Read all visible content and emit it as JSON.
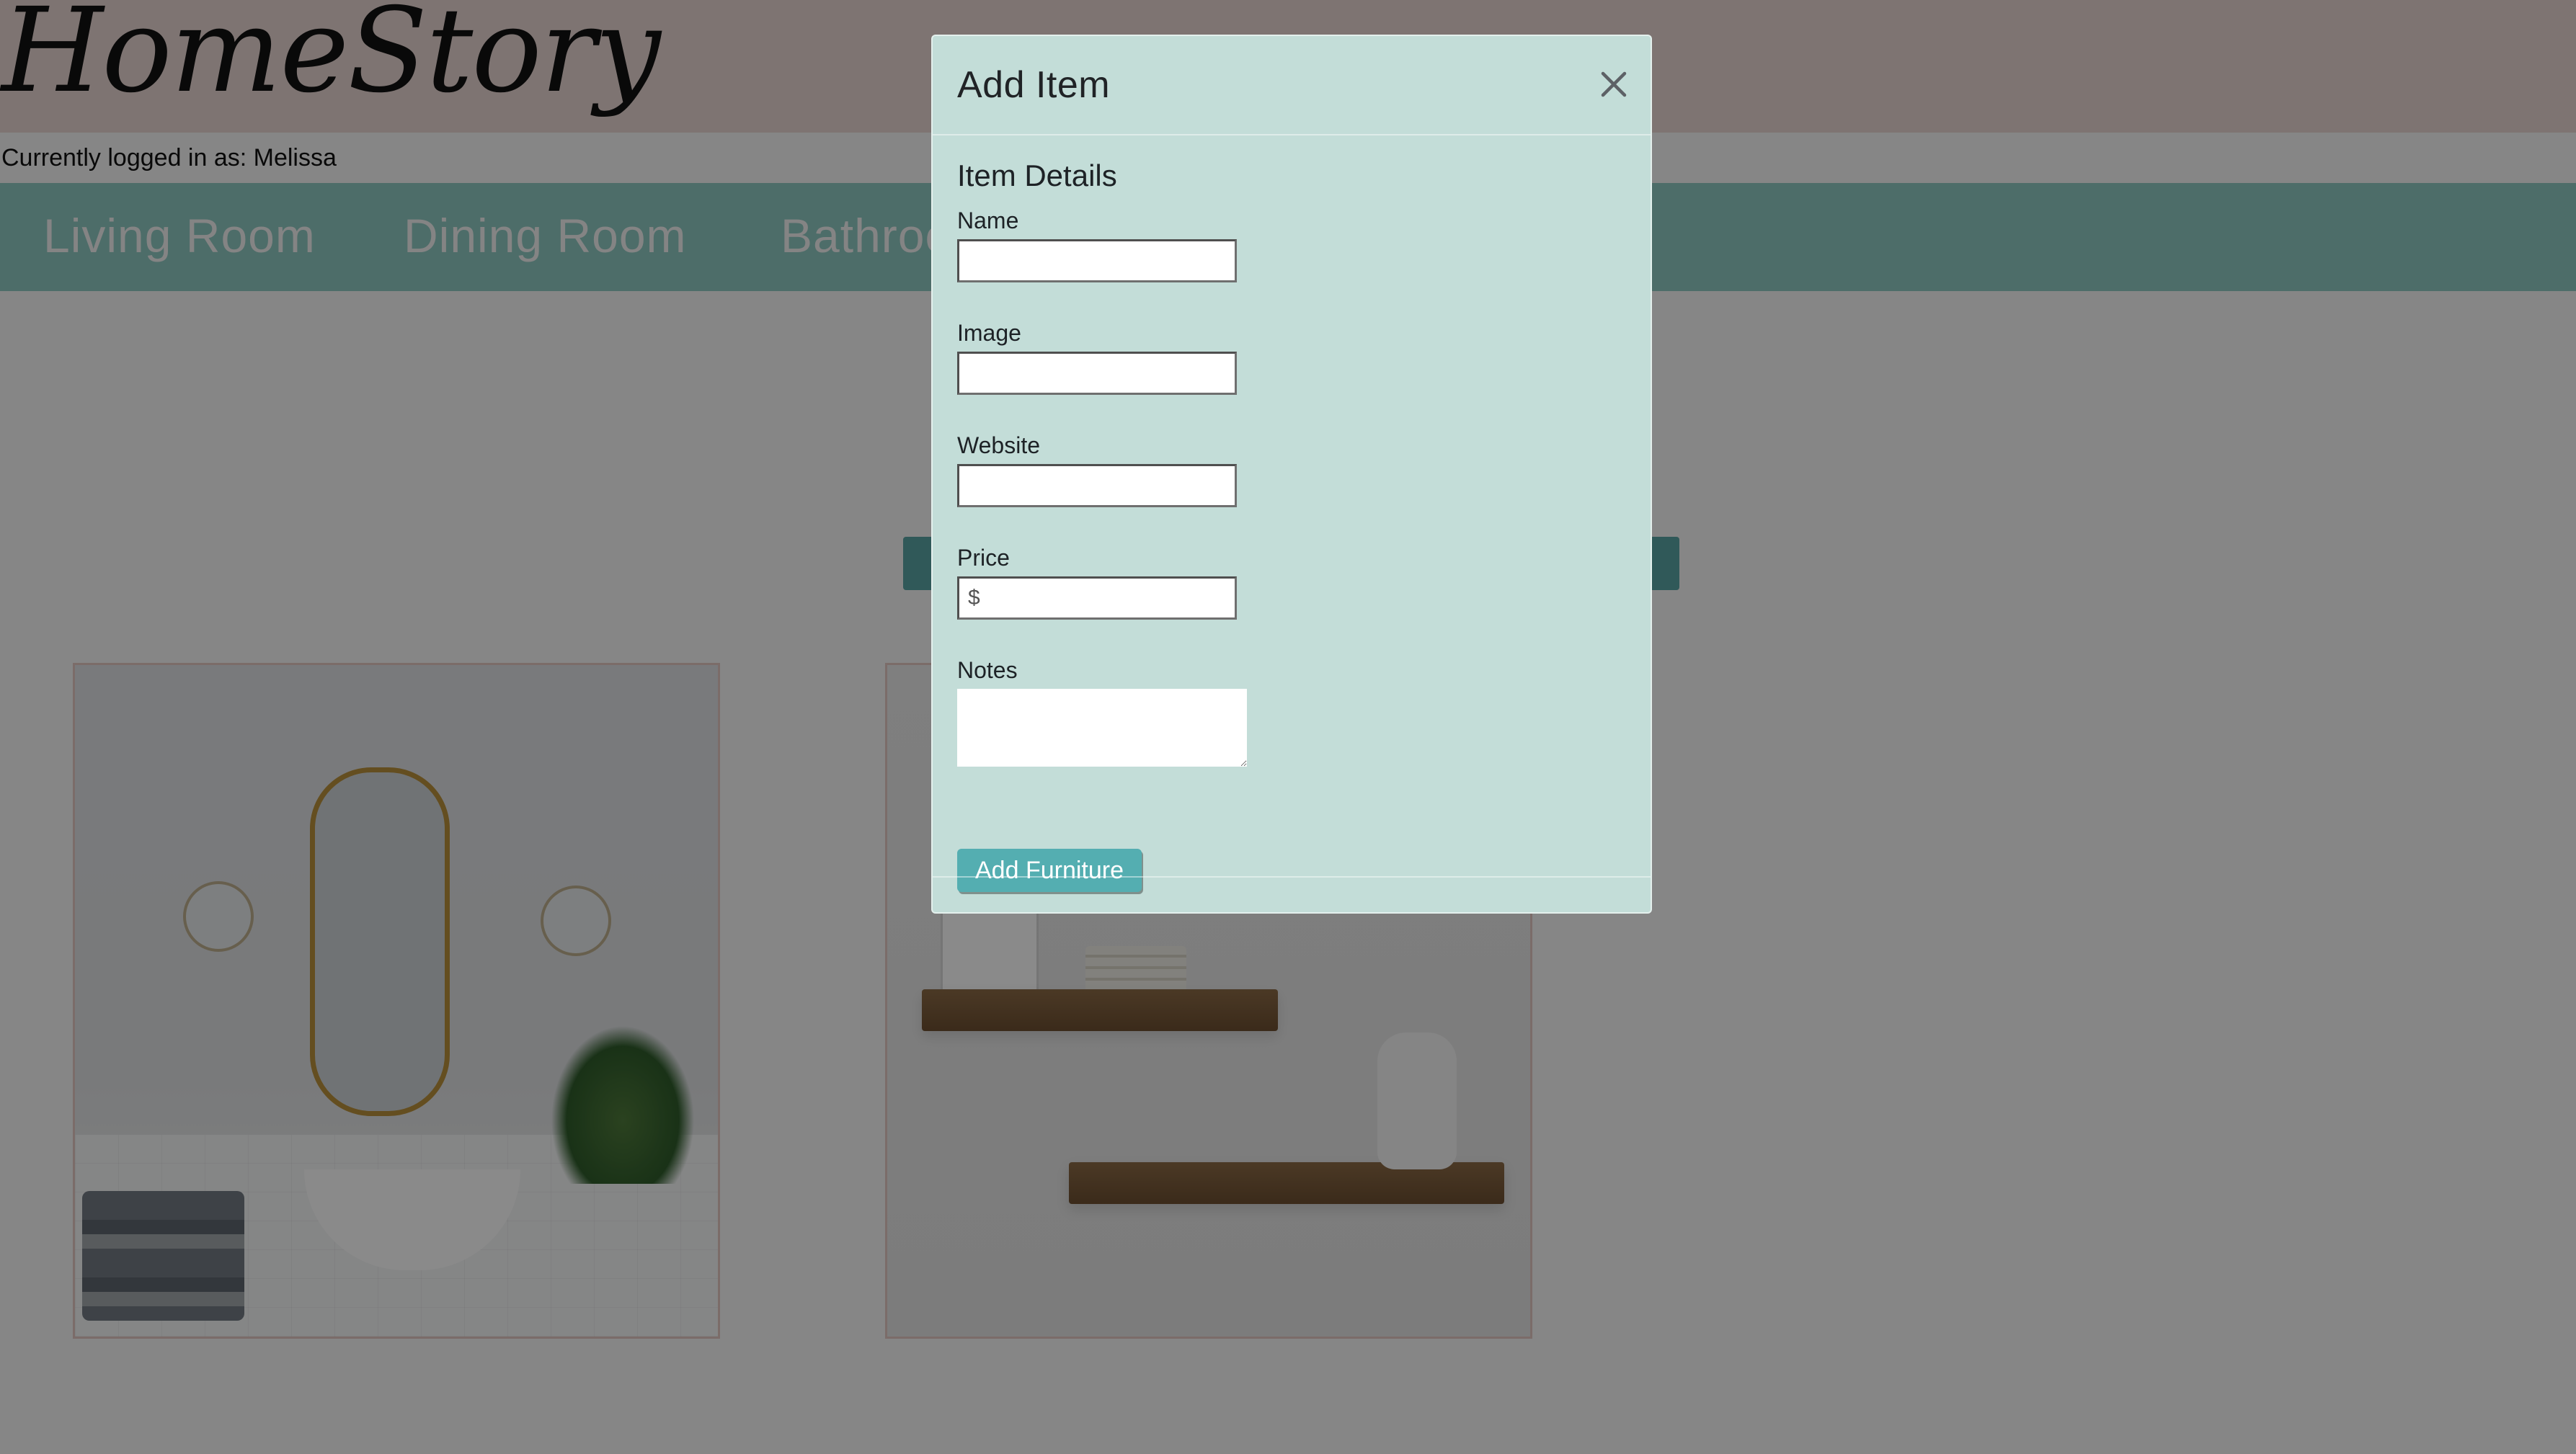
{
  "app": {
    "brand": "HomeStory",
    "logged_in_text": "Currently logged in as: Melissa"
  },
  "nav": {
    "items": [
      {
        "label": "Living Room"
      },
      {
        "label": "Dining Room"
      },
      {
        "label": "Bathroom"
      }
    ]
  },
  "modal": {
    "title": "Add Item",
    "section_title": "Item Details",
    "fields": {
      "name_label": "Name",
      "image_label": "Image",
      "website_label": "Website",
      "price_label": "Price",
      "notes_label": "Notes",
      "price_placeholder": "$"
    },
    "submit_label": "Add Furniture",
    "close_icon": "close-icon"
  },
  "colors": {
    "header_bg": "#e9d7d3",
    "nav_bg": "#8fc9c2",
    "modal_bg": "#c3ddd8",
    "button_bg": "#54aeb1",
    "overlay": "rgba(0,0,0,0.46)"
  }
}
